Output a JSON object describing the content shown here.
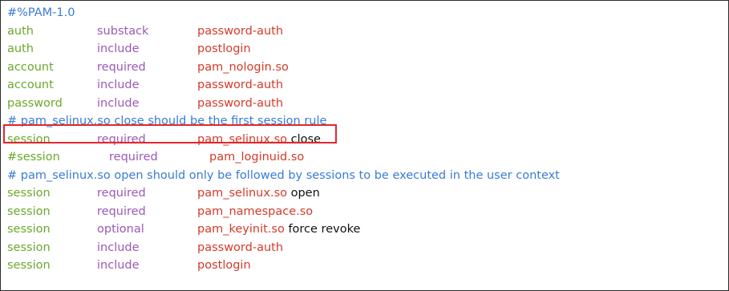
{
  "file": {
    "lines": [
      {
        "type": "comment",
        "text": "#%PAM-1.0"
      },
      {
        "type": "rule",
        "ctype": "auth",
        "control": "substack",
        "module": "password-auth",
        "args": ""
      },
      {
        "type": "rule",
        "ctype": "auth",
        "control": "include",
        "module": "postlogin",
        "args": ""
      },
      {
        "type": "rule",
        "ctype": "account",
        "control": "required",
        "module": "pam_nologin.so",
        "args": ""
      },
      {
        "type": "rule",
        "ctype": "account",
        "control": "include",
        "module": "password-auth",
        "args": ""
      },
      {
        "type": "rule",
        "ctype": "password",
        "control": "include",
        "module": "password-auth",
        "args": ""
      },
      {
        "type": "comment",
        "text": "# pam_selinux.so close should be the first session rule"
      },
      {
        "type": "rule",
        "ctype": "session",
        "control": "required",
        "module": "pam_selinux.so",
        "args": "close"
      },
      {
        "type": "highlight",
        "ctype": "#session",
        "control": "required",
        "module": "pam_loginuid.so",
        "args": ""
      },
      {
        "type": "comment",
        "text": "# pam_selinux.so open should only be followed by sessions to be executed in the user context"
      },
      {
        "type": "rule",
        "ctype": "session",
        "control": "required",
        "module": "pam_selinux.so",
        "args": "open"
      },
      {
        "type": "rule",
        "ctype": "session",
        "control": "required",
        "module": "pam_namespace.so",
        "args": ""
      },
      {
        "type": "rule",
        "ctype": "session",
        "control": "optional",
        "module": "pam_keyinit.so",
        "args": "force revoke"
      },
      {
        "type": "rule",
        "ctype": "session",
        "control": "include",
        "module": "password-auth",
        "args": ""
      },
      {
        "type": "rule",
        "ctype": "session",
        "control": "include",
        "module": "postlogin",
        "args": ""
      }
    ]
  },
  "colors": {
    "type_keyword": "#6ba82d",
    "control_flag": "#9b59b6",
    "module_name": "#d43b2a",
    "argument": "#111111",
    "comment": "#3a7bd5",
    "highlight_border": "#e0282e"
  }
}
